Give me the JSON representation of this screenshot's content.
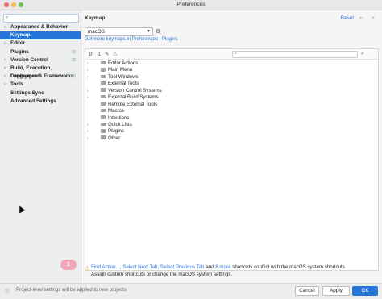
{
  "window": {
    "title": "Preferences"
  },
  "sidebar": {
    "search_placeholder": "",
    "items": [
      {
        "label": "Appearance & Behavior",
        "expandable": true
      },
      {
        "label": "Keymap",
        "selected": true
      },
      {
        "label": "Editor",
        "expandable": true
      },
      {
        "label": "Plugins",
        "badge": "⊞"
      },
      {
        "label": "Version Control",
        "expandable": true,
        "badge": "⊞"
      },
      {
        "label": "Build, Execution, Deployment",
        "expandable": true
      },
      {
        "label": "Languages & Frameworks",
        "expandable": true,
        "badge": "⊞"
      },
      {
        "label": "Tools",
        "expandable": true
      },
      {
        "label": "Settings Sync"
      },
      {
        "label": "Advanced Settings"
      }
    ]
  },
  "content": {
    "heading": "Keymap",
    "reset_label": "Reset",
    "keymap_value": "macOS",
    "get_more_link": "Get more keymaps in Preferences | Plugins",
    "filter_placeholder": "",
    "tree": [
      {
        "label": "Editor Actions",
        "expandable": true,
        "folder": true
      },
      {
        "label": "Main Menu",
        "expandable": true,
        "folder": true
      },
      {
        "label": "Tool Windows",
        "expandable": true,
        "folder": true
      },
      {
        "label": "External Tools",
        "expandable": false,
        "folder": true
      },
      {
        "label": "Version Control Systems",
        "expandable": true,
        "folder": true
      },
      {
        "label": "External Build Systems",
        "expandable": true,
        "folder": true
      },
      {
        "label": "Remote External Tools",
        "expandable": false,
        "folder": true
      },
      {
        "label": "Macros",
        "expandable": false,
        "folder": true
      },
      {
        "label": "Intentions",
        "expandable": false,
        "folder": true
      },
      {
        "label": "Quick Lists",
        "expandable": true,
        "folder": true
      },
      {
        "label": "Plugins",
        "expandable": true,
        "folder": true
      },
      {
        "label": "Other",
        "expandable": true,
        "folder": true
      }
    ],
    "warning": {
      "link1": "Find Action...",
      "sep1": ", ",
      "link2": "Select Next Tab",
      "sep2": ", ",
      "link3": "Select Previous Tab",
      "and": " and ",
      "link4": "8 more",
      "rest": " shortcuts conflict with the macOS system shortcuts.",
      "line2": "Assign custom shortcuts or change the macOS system settings."
    },
    "callout_number": "1"
  },
  "footer": {
    "info_text": "Project-level settings will be applied to new projects",
    "cancel_label": "Cancel",
    "apply_label": "Apply",
    "ok_label": "OK"
  },
  "colors": {
    "accent": "#2675d8",
    "warning": "#d9a300",
    "callout": "#f2a8bb"
  }
}
